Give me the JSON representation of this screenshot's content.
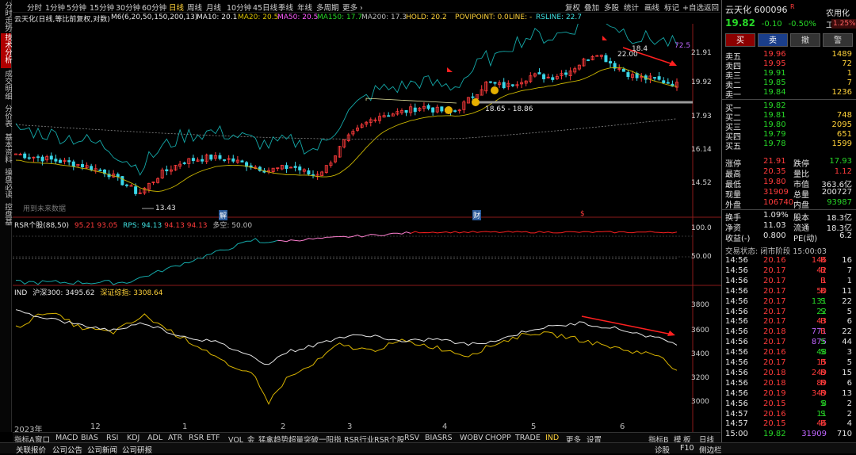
{
  "vtabs": [
    {
      "label": "分时走势",
      "active": false
    },
    {
      "label": "技术分析",
      "active": true
    },
    {
      "label": "成交明细",
      "active": false
    },
    {
      "label": "分价表",
      "active": false
    },
    {
      "label": "基本资料",
      "active": false
    },
    {
      "label": "操盘必读",
      "active": false
    },
    {
      "label": "控盘基",
      "active": false
    }
  ],
  "toolbar": {
    "periods": [
      "分时",
      "1分钟",
      "5分钟",
      "15分钟",
      "30分钟",
      "60分钟",
      "日线",
      "周线",
      "月线",
      "10分钟",
      "45日线",
      "季线",
      "年线",
      "多周期",
      "更多 ›"
    ],
    "active_period": "日线",
    "tools": [
      "复权",
      "叠加",
      "多股",
      "统计",
      "画线",
      "标记",
      "+自选",
      "返回"
    ]
  },
  "info": {
    "name": "云天化(日线,等比前复权,对数)",
    "ma": "M6(6,20,50,150,200,13)",
    "ma10": "MA10: 20.1",
    "ma20": "MA20: 20.5",
    "ma50": "MA50: 20.5",
    "ma150": "MA150: 17.7",
    "ma200": "MA200: 17.3",
    "hold": "HOLD: 20.2",
    "povi": "POVIPOINT: 0.0",
    "line": "LINE: -",
    "rsline": "RSLINE: 22.7"
  },
  "colors": {
    "up": "#ff3b3b",
    "down": "#3ad7e8",
    "ma_yellow": "#c8b400",
    "rs_teal": "#14a8a8",
    "ind_white": "#e6e6e6",
    "ind_gold": "#d9b400",
    "support": "#9a9a9a"
  },
  "main_chart": {
    "y_ticks": [
      "21.91",
      "19.92",
      "17.93",
      "16.14",
      "14.52"
    ],
    "annotations": {
      "high": "22.00",
      "low": "13.43",
      "range": "18.65 - 18.86",
      "rs_value": "72.5",
      "near_high": "18.4"
    },
    "markers": [
      "解",
      "财",
      "$"
    ],
    "watermark": "用到未来数据"
  },
  "rsr": {
    "label": "RSR个股(88,50)",
    "value": "95.21",
    "value2": "93.05",
    "rps": "RPS: 94.13",
    "v3": "94.13",
    "v4": "94.13",
    "duo": "多空: 50.00",
    "y_ticks": [
      "100.0",
      "50.00"
    ]
  },
  "ind": {
    "label": "IND",
    "hs300": "沪深300: 3495.62",
    "szzz": "深证综指: 3308.64",
    "y_ticks": [
      "3800",
      "3600",
      "3400",
      "3200",
      "3000"
    ]
  },
  "x_axis": [
    "2023年",
    "12",
    "1",
    "2",
    "3",
    "4",
    "5",
    "6"
  ],
  "bottom_tabs": [
    "指标A",
    "窗口",
    "MACD",
    "BIAS",
    "RSI",
    "KDJ",
    "ADL",
    "ATR",
    "RSR ETF",
    "VOL_金",
    "猛禽趋势",
    "超量突破",
    "一阳指",
    "RSR行业",
    "RSR个股",
    "RSV",
    "BIASRS",
    "WOBV",
    "CHOPP",
    "TRADE",
    "IND",
    "更多",
    "设置"
  ],
  "bottom_active": "IND",
  "bottom_right": [
    "指标B",
    "模",
    "板",
    "日线"
  ],
  "status": {
    "left": [
      "关联报价",
      "公司公告",
      "公司新闻",
      "公司研报"
    ],
    "right": [
      "诊股",
      "F10",
      "侧边栏"
    ]
  },
  "quote": {
    "name": "云天化",
    "code": "600096",
    "tag": "R",
    "industry": "农用化工",
    "price": "19.82",
    "change": "-0.10",
    "pct": "-0.50%",
    "wb": "1.25%",
    "buy_btn": "买",
    "sell_btn": "卖",
    "cancel_btn": "撤",
    "alert_btn": "警",
    "asks": [
      {
        "l": "卖五",
        "p": "19.96",
        "v": "1489"
      },
      {
        "l": "卖四",
        "p": "19.95",
        "v": "72"
      },
      {
        "l": "卖三",
        "p": "19.91",
        "v": "1"
      },
      {
        "l": "卖二",
        "p": "19.85",
        "v": "7"
      },
      {
        "l": "卖一",
        "p": "19.84",
        "v": "1236"
      }
    ],
    "bids": [
      {
        "l": "买一",
        "p": "19.82",
        "v": ""
      },
      {
        "l": "买二",
        "p": "19.81",
        "v": "748"
      },
      {
        "l": "买三",
        "p": "19.80",
        "v": "2095"
      },
      {
        "l": "买四",
        "p": "19.79",
        "v": "651"
      },
      {
        "l": "买五",
        "p": "19.78",
        "v": "1599"
      }
    ],
    "stats": [
      [
        "涨停",
        "21.91",
        "跌停",
        "17.93"
      ],
      [
        "最高",
        "20.35",
        "量比",
        "1.12"
      ],
      [
        "最低",
        "19.80",
        "市值",
        "363.6亿"
      ],
      [
        "现量",
        "31909",
        "总量",
        "200727"
      ],
      [
        "外盘",
        "106740",
        "内盘",
        "93987"
      ]
    ],
    "stats2": [
      [
        "换手",
        "1.09%",
        "股本",
        "18.3亿"
      ],
      [
        "净资",
        "11.03",
        "流通",
        "18.3亿"
      ],
      [
        "收益(-)",
        "0.800",
        "PE(动)",
        "6.2"
      ]
    ],
    "trade_state": "交易状态: 闭市阶段 15:00:03",
    "ticks": [
      [
        "14:56",
        "20.16",
        "146",
        "B",
        "16"
      ],
      [
        "14:56",
        "20.17",
        "42",
        "B",
        "7"
      ],
      [
        "14:56",
        "20.17",
        "1",
        "B",
        "1"
      ],
      [
        "14:56",
        "20.17",
        "50",
        "B",
        "11"
      ],
      [
        "14:56",
        "20.17",
        "131",
        "S",
        "22"
      ],
      [
        "14:56",
        "20.17",
        "22",
        "S",
        "5"
      ],
      [
        "14:56",
        "20.17",
        "43",
        "B",
        "6"
      ],
      [
        "14:56",
        "20.18",
        "771",
        "B",
        "22"
      ],
      [
        "14:56",
        "20.17",
        "875",
        "S",
        "44"
      ],
      [
        "14:56",
        "20.16",
        "48",
        "S",
        "3"
      ],
      [
        "14:56",
        "20.17",
        "15",
        "B",
        "5"
      ],
      [
        "14:56",
        "20.18",
        "249",
        "B",
        "15"
      ],
      [
        "14:56",
        "20.18",
        "89",
        "B",
        "6"
      ],
      [
        "14:56",
        "20.19",
        "349",
        "B",
        "13"
      ],
      [
        "14:56",
        "20.15",
        "8",
        "S",
        "2"
      ],
      [
        "14:57",
        "20.16",
        "11",
        "S",
        "2"
      ],
      [
        "14:57",
        "20.15",
        "46",
        "B",
        "4"
      ],
      [
        "15:00",
        "19.82",
        "31909",
        "",
        "710"
      ]
    ]
  }
}
